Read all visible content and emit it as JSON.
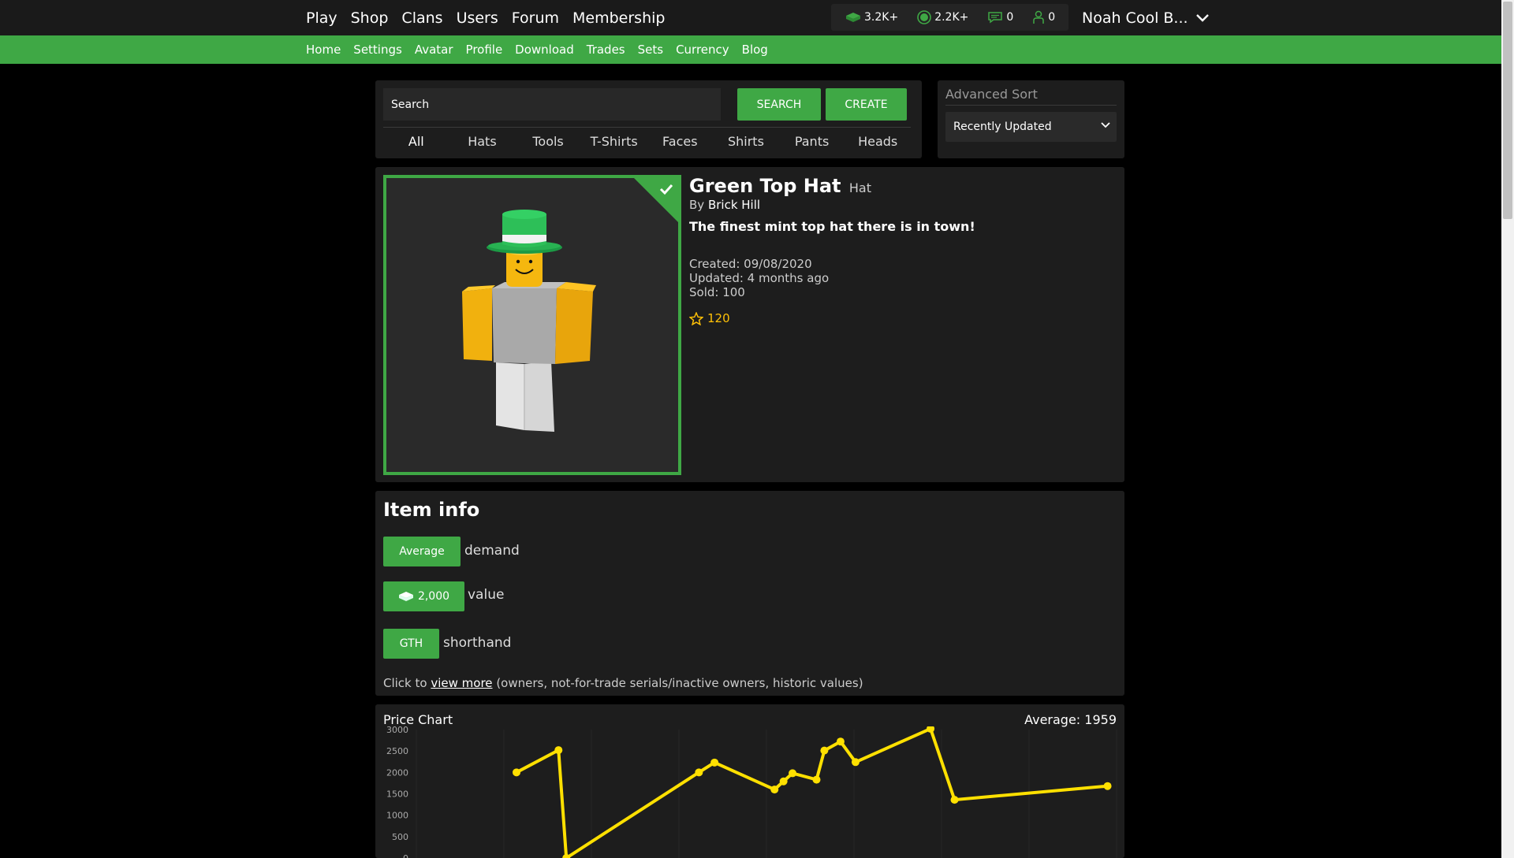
{
  "topnav": {
    "items": [
      "Play",
      "Shop",
      "Clans",
      "Users",
      "Forum",
      "Membership"
    ]
  },
  "stats": {
    "bucks": "3.2K+",
    "bits": "2.2K+",
    "messages": "0",
    "friends": "0"
  },
  "user": {
    "name": "Noah Cool B..."
  },
  "subnav": {
    "items": [
      "Home",
      "Settings",
      "Avatar",
      "Profile",
      "Download",
      "Trades",
      "Sets",
      "Currency",
      "Blog"
    ]
  },
  "search": {
    "placeholder": "Search",
    "search_label": "SEARCH",
    "create_label": "CREATE"
  },
  "tabs": [
    "All",
    "Hats",
    "Tools",
    "T-Shirts",
    "Faces",
    "Shirts",
    "Pants",
    "Heads"
  ],
  "sort": {
    "label": "Advanced Sort",
    "selected": "Recently Updated"
  },
  "item": {
    "name": "Green Top Hat",
    "type": "Hat",
    "by_prefix": "By",
    "creator": "Brick Hill",
    "description": "The finest mint top hat there is in town!",
    "created": "Created: 09/08/2020",
    "updated": "Updated: 4 months ago",
    "sold": "Sold: 100",
    "favorites": "120"
  },
  "item_info": {
    "title": "Item info",
    "demand_value": "Average",
    "demand_label": "demand",
    "value_value": "2,000",
    "value_label": "value",
    "shorthand_value": "GTH",
    "shorthand_label": "shorthand",
    "click_prefix": "Click to",
    "view_more": "view more",
    "click_suffix": "(owners, not-for-trade serials/inactive owners, historic values)"
  },
  "colors": {
    "green": "#3fa845",
    "line": "#ffe000",
    "star": "#ffc107"
  },
  "chart_data": {
    "type": "line",
    "title": "Price Chart",
    "average_label": "Average: 1959",
    "ylim": [
      0,
      3000
    ],
    "yticks": [
      3000,
      2500,
      2000,
      1500,
      1000,
      500,
      0
    ],
    "grid": true,
    "points": [
      [
        0.0,
        2000
      ],
      [
        0.07,
        2520
      ],
      [
        0.083,
        0
      ],
      [
        0.304,
        2000
      ],
      [
        0.33,
        2230
      ],
      [
        0.43,
        1600
      ],
      [
        0.445,
        1790
      ],
      [
        0.46,
        1980
      ],
      [
        0.5,
        1830
      ],
      [
        0.513,
        2510
      ],
      [
        0.54,
        2720
      ],
      [
        0.565,
        2240
      ],
      [
        0.69,
        3020
      ],
      [
        0.73,
        1360
      ],
      [
        0.985,
        1680
      ]
    ]
  }
}
